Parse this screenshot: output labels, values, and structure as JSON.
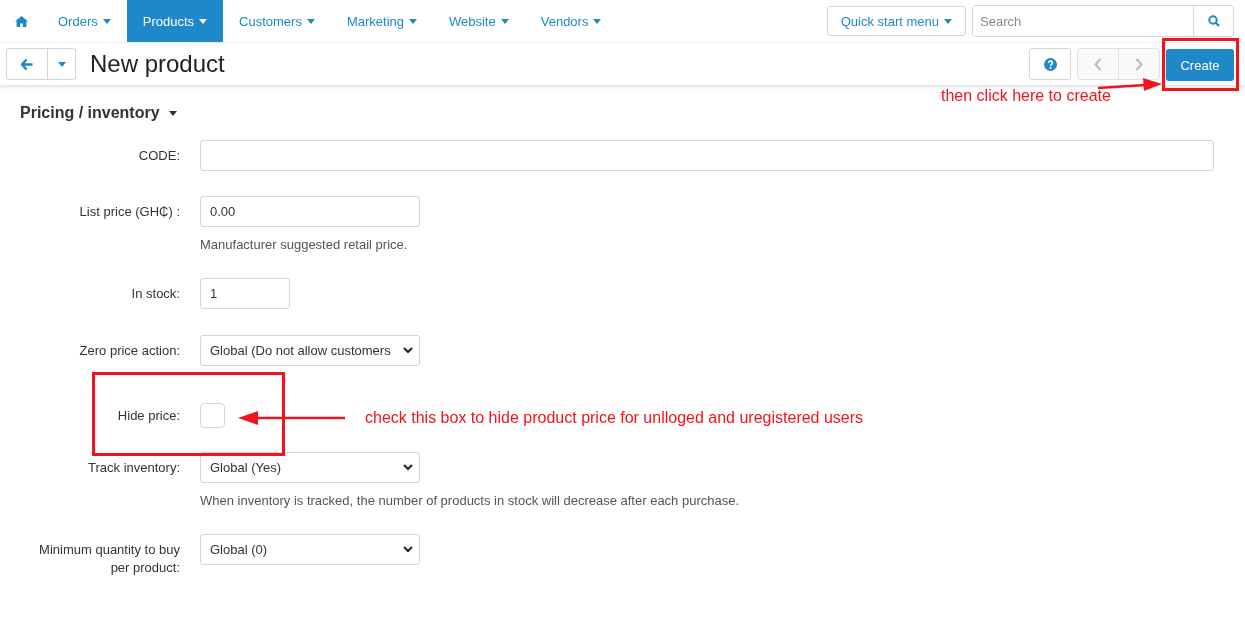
{
  "nav": {
    "items": [
      {
        "label": "Orders",
        "selected": false
      },
      {
        "label": "Products",
        "selected": true
      },
      {
        "label": "Customers",
        "selected": false
      },
      {
        "label": "Marketing",
        "selected": false
      },
      {
        "label": "Website",
        "selected": false
      },
      {
        "label": "Vendors",
        "selected": false
      }
    ],
    "quick_start": "Quick start menu",
    "search": {
      "placeholder": "Search"
    }
  },
  "header": {
    "title": "New product",
    "create_button": "Create",
    "prev_disabled": true,
    "next_disabled": true
  },
  "section": {
    "title": "Pricing / inventory"
  },
  "fields": [
    {
      "kind": "text",
      "label": "CODE:"
    },
    {
      "kind": "text",
      "label": "List price (GH₵) :",
      "value": "0.00",
      "help": "Manufacturer suggested retail price."
    },
    {
      "kind": "text",
      "label": "In stock:",
      "value": "1"
    },
    {
      "kind": "select",
      "label": "Zero price action:",
      "value": "Global (Do not allow customers"
    },
    {
      "kind": "checkbox",
      "label": "Hide price:",
      "checked": false
    },
    {
      "kind": "select",
      "label": "Track inventory:",
      "value": "Global (Yes)",
      "help": "When inventory is tracked, the number of products in stock will decrease after each purchase."
    },
    {
      "kind": "select",
      "label": "Minimum quantity to buy per product:",
      "value": "Global (0)"
    }
  ],
  "annotations": [
    {
      "text": "then click here to create"
    },
    {
      "text": "check this box to hide product price for unlloged and uregistered users"
    }
  ]
}
